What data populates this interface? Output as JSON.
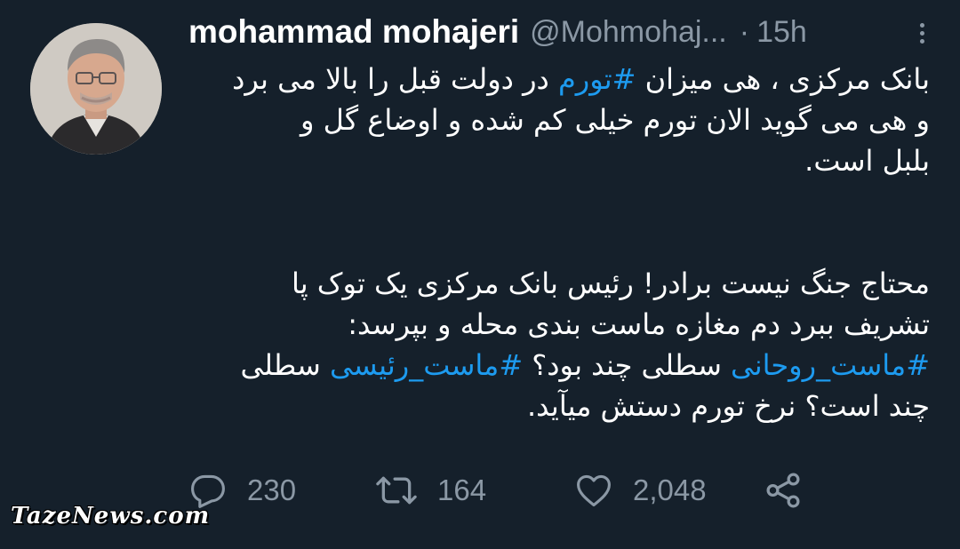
{
  "author": {
    "display_name": "mohammad mohajeri",
    "handle": "@Mohmohaj...",
    "separator": "·",
    "timestamp": "15h"
  },
  "tweet": {
    "paragraph1": [
      [
        {
          "text": "بانک مرکزی ، هی میزان "
        },
        {
          "text": "#تورم",
          "hashtag": true
        },
        {
          "text": " در دولت قبل را بالا می برد"
        }
      ],
      [
        {
          "text": "و هی می گوید الان تورم خیلی کم شده و اوضاع گل و"
        }
      ],
      [
        {
          "text": "بلبل است."
        }
      ]
    ],
    "paragraph2": [
      [
        {
          "text": "محتاج جنگ نیست برادر! رئیس بانک مرکزی یک توک پا"
        }
      ],
      [
        {
          "text": "تشریف ببرد دم مغازه ماست بندی محله و بپرسد:"
        }
      ],
      [
        {
          "text": "#ماست_روحانی",
          "hashtag": true
        },
        {
          "text": " سطلی چند بود؟ "
        },
        {
          "text": "#ماست_رئیسی",
          "hashtag": true
        },
        {
          "text": " سطلی"
        }
      ],
      [
        {
          "text": "چند است؟ نرخ تورم دستش میآید."
        }
      ]
    ]
  },
  "actions": {
    "replies": "230",
    "retweets": "164",
    "likes": "2,048"
  },
  "icons": {
    "reply": "reply-bubble-icon",
    "retweet": "retweet-icon",
    "like": "heart-icon",
    "share": "share-icon",
    "more": "more-vertical-icon"
  },
  "colors": {
    "background": "#15202b",
    "hashtag": "#1d9bf0",
    "muted": "#8b98a5"
  },
  "watermark": "TazeNews.com"
}
